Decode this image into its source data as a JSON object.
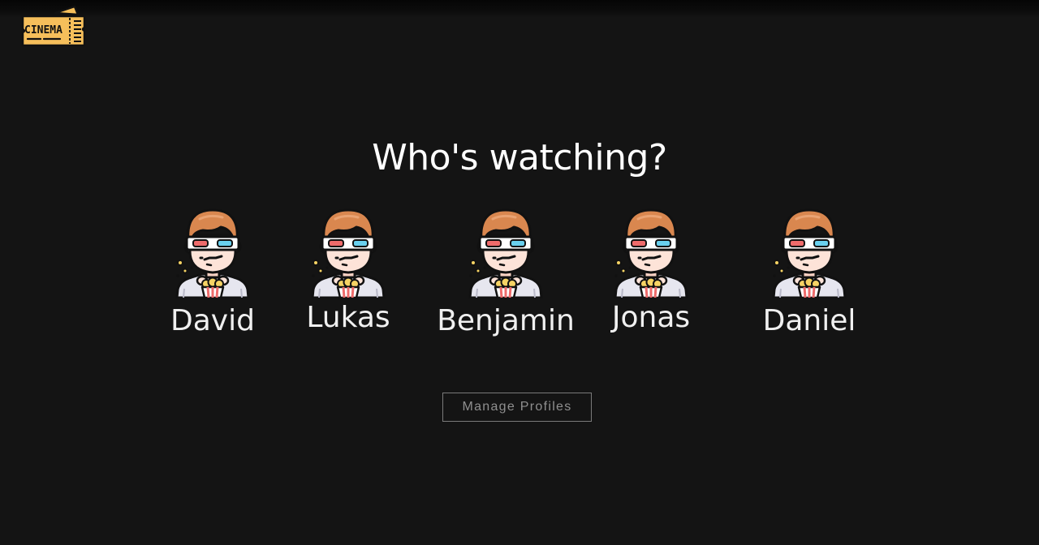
{
  "header": {
    "logo_text": "CINEMA"
  },
  "main": {
    "title": "Who's watching?",
    "profiles": [
      {
        "name": "David"
      },
      {
        "name": "Lukas"
      },
      {
        "name": "Benjamin"
      },
      {
        "name": "Jonas"
      },
      {
        "name": "Daniel"
      }
    ],
    "manage_label": "Manage Profiles"
  },
  "icons": {
    "logo": "cinema-ticket-icon",
    "avatar": "moviegoer-3d-glasses-popcorn-icon"
  },
  "colors": {
    "background": "#141414",
    "text": "#ffffff",
    "logo_yellow": "#f6bf5b",
    "hair": "#d9874f",
    "skin": "#fde3d8",
    "glasses_red": "#ee6b6b",
    "glasses_blue": "#69d0ee",
    "shirt": "#e6e6ef",
    "button_border": "#7a7a7a"
  }
}
